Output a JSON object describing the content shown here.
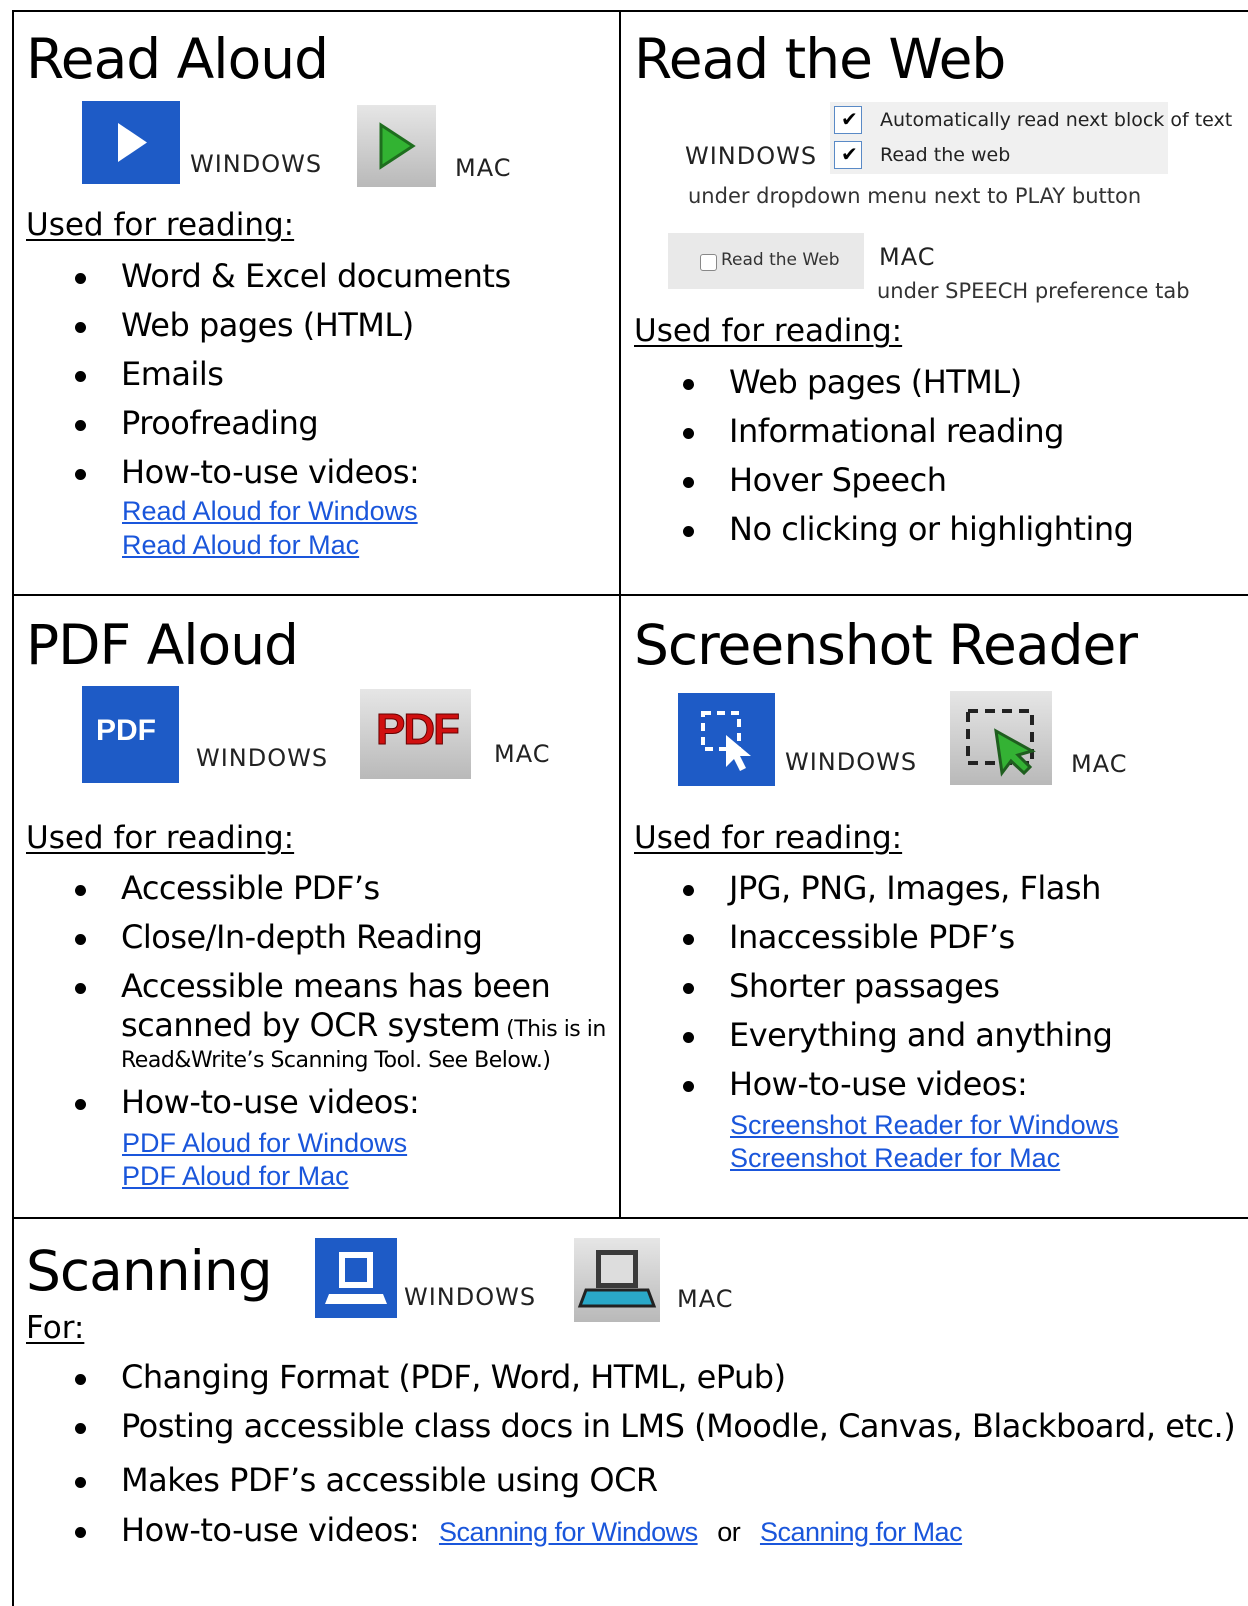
{
  "read_aloud": {
    "title": "Read Aloud",
    "win_label": "WINDOWS",
    "mac_label": "MAC",
    "used_for": "Used for reading:",
    "items": [
      "Word & Excel documents",
      "Web pages (HTML)",
      "Emails",
      "Proofreading",
      "How-to-use videos:"
    ],
    "links": [
      "Read Aloud for Windows",
      "Read Aloud for Mac"
    ]
  },
  "read_web": {
    "title": "Read the Web",
    "win_label": "WINDOWS",
    "checkbox_1": "Automatically read next block of text",
    "checkbox_2": "Read the web",
    "win_note": "under dropdown menu next to PLAY button",
    "mac_checkbox": "Read the Web",
    "mac_label": "MAC",
    "mac_note": "under SPEECH preference tab",
    "used_for": "Used for reading:",
    "items": [
      "Web pages (HTML)",
      "Informational reading",
      "Hover Speech",
      "No clicking or highlighting"
    ]
  },
  "pdf_aloud": {
    "title": "PDF Aloud",
    "win_icon_text": "PDF",
    "win_label": "WINDOWS",
    "mac_icon_text": "PDF",
    "mac_label": "MAC",
    "used_for": "Used for reading:",
    "items": [
      "Accessible PDF’s",
      "Close/In-depth Reading",
      "Accessible means has been"
    ],
    "item3_line2": "scanned by OCR system",
    "item3_small": "(This is in",
    "item3_line3": "Read&Write’s Scanning Tool.  See Below.)",
    "item4": "How-to-use videos:",
    "links": [
      "PDF Aloud for Windows",
      "PDF Aloud for Mac"
    ]
  },
  "screenshot_reader": {
    "title": "Screenshot Reader",
    "win_label": "WINDOWS",
    "mac_label": "MAC",
    "used_for": "Used for reading:",
    "items": [
      "JPG, PNG, Images, Flash",
      "Inaccessible PDF’s",
      "Shorter passages",
      "Everything and anything",
      "How-to-use videos:"
    ],
    "links": [
      "Screenshot Reader for Windows",
      "Screenshot Reader for Mac"
    ]
  },
  "scanning": {
    "title": "Scanning",
    "win_label": "WINDOWS",
    "mac_label": "MAC",
    "for_label": "For:",
    "items": [
      "Changing Format (PDF, Word, HTML, ePub)",
      "Posting accessible class docs in LMS (Moodle, Canvas, Blackboard, etc.)",
      "Makes PDF’s accessible using OCR"
    ],
    "videos_label": "How-to-use videos:",
    "link_windows": "Scanning for Windows",
    "or_text": "or",
    "link_mac": "Scanning for Mac"
  },
  "colors": {
    "windows_blue": "#1e5bc6",
    "link_blue": "#1a56db",
    "mac_green": "#2fa52f",
    "mac_red": "#d01010"
  },
  "icons": [
    "play-icon",
    "read-the-web-checkbox-icon",
    "pdf-icon",
    "screenshot-select-icon",
    "scanner-icon"
  ]
}
